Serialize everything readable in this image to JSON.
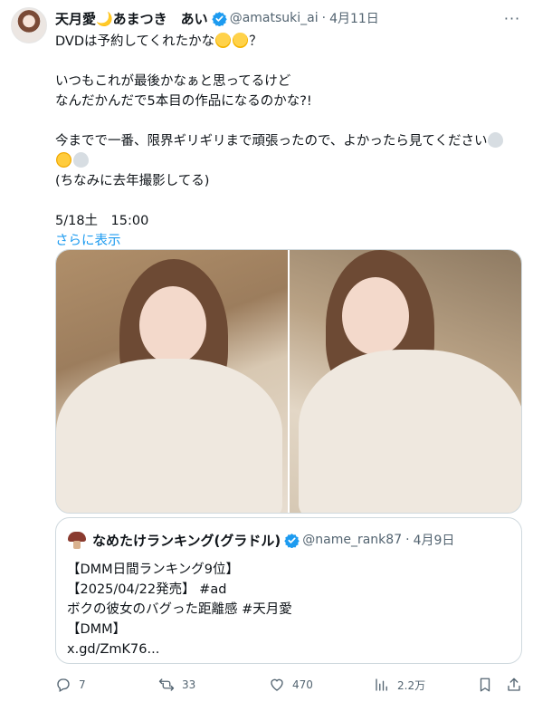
{
  "tweet": {
    "display_name": "天月愛🌙あまつき　あい",
    "handle": "@amatsuki_ai",
    "dot": "·",
    "date": "4月11日",
    "more_label": "···",
    "body_lines": [
      "DVDは予約してくれたかな",
      "？",
      "いつもこれが最後かなぁと思ってるけど",
      "なんだかんだで5本目の作品になるのかな?!",
      "今までで一番、限界ギリギリまで頑張ったので、よかったら見てください",
      "(ちなみに去年撮影してる)",
      "5/18土　15:00"
    ],
    "show_more": "さらに表示"
  },
  "quote": {
    "name": "なめたけランキング(グラドル)",
    "handle": "@name_rank87",
    "dot": "·",
    "date": "4月9日",
    "lines": [
      "【DMM日間ランキング9位】",
      "【2025/04/22発売】 #ad",
      "ボクの彼女のバグった距離感 #天月愛",
      "【DMM】",
      "x.gd/ZmK76..."
    ]
  },
  "actions": {
    "replies": "7",
    "reposts": "33",
    "likes": "470",
    "views": "2.2万"
  },
  "colors": {
    "accent": "#1d9bf0",
    "secondary_text": "#536471",
    "border": "#cfd9de"
  },
  "icons": [
    "verified-badge-icon",
    "more-icon",
    "reply-icon",
    "repost-icon",
    "like-icon",
    "views-icon",
    "bookmark-icon",
    "share-icon"
  ]
}
